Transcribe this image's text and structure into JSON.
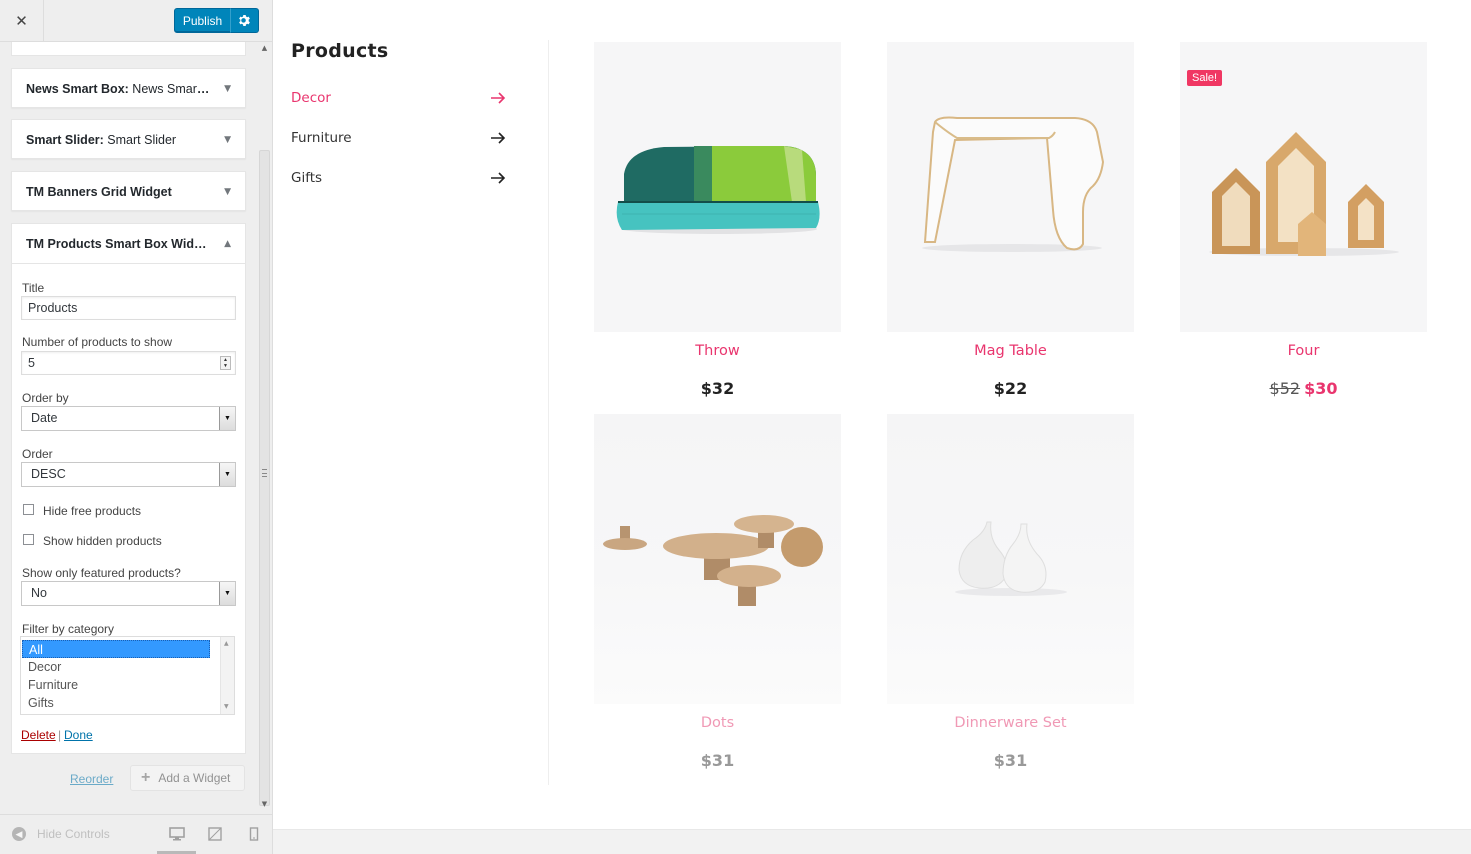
{
  "customizer": {
    "close_glyph": "✕",
    "publish_label": "Publish",
    "widgets": [
      {
        "title": "News Smart Box:",
        "instance": "News Smart Box"
      },
      {
        "title": "Smart Slider:",
        "instance": "Smart Slider"
      },
      {
        "title": "TM Banners Grid Widget",
        "instance": ""
      }
    ],
    "open_widget": {
      "title": "TM Products Smart Box Widget",
      "fields": {
        "title_label": "Title",
        "title_value": "Products",
        "count_label": "Number of products to show",
        "count_value": "5",
        "orderby_label": "Order by",
        "orderby_value": "Date",
        "order_label": "Order",
        "order_value": "DESC",
        "hide_free_label": "Hide free products",
        "show_hidden_label": "Show hidden products",
        "featured_label": "Show only featured products?",
        "featured_value": "No",
        "category_label": "Filter by category",
        "categories": [
          "All",
          "Decor",
          "Furniture",
          "Gifts"
        ],
        "selected_category": "All"
      },
      "delete_label": "Delete",
      "separator": "|",
      "done_label": "Done"
    },
    "reorder_label": "Reorder",
    "add_widget_label": "Add a Widget",
    "hide_controls_label": "Hide Controls"
  },
  "preview": {
    "box_title": "Products",
    "categories": [
      {
        "label": "Decor",
        "active": true
      },
      {
        "label": "Furniture",
        "active": false
      },
      {
        "label": "Gifts",
        "active": false
      }
    ],
    "products": [
      {
        "name": "Throw",
        "price": "$32",
        "image": "blanket"
      },
      {
        "name": "Mag Table",
        "price": "$22",
        "image": "table"
      },
      {
        "name": "Four",
        "old_price": "$52",
        "price": "$30",
        "badge": "Sale!",
        "image": "wooden-houses"
      },
      {
        "name": "Dots",
        "price": "$31",
        "image": "wooden-dots"
      },
      {
        "name": "Dinnerware Set",
        "price": "$31",
        "image": "vases"
      }
    ]
  },
  "colors": {
    "accent": "#e9356e",
    "publish": "#0085ba",
    "link": "#0073aa",
    "delete": "#a00"
  }
}
